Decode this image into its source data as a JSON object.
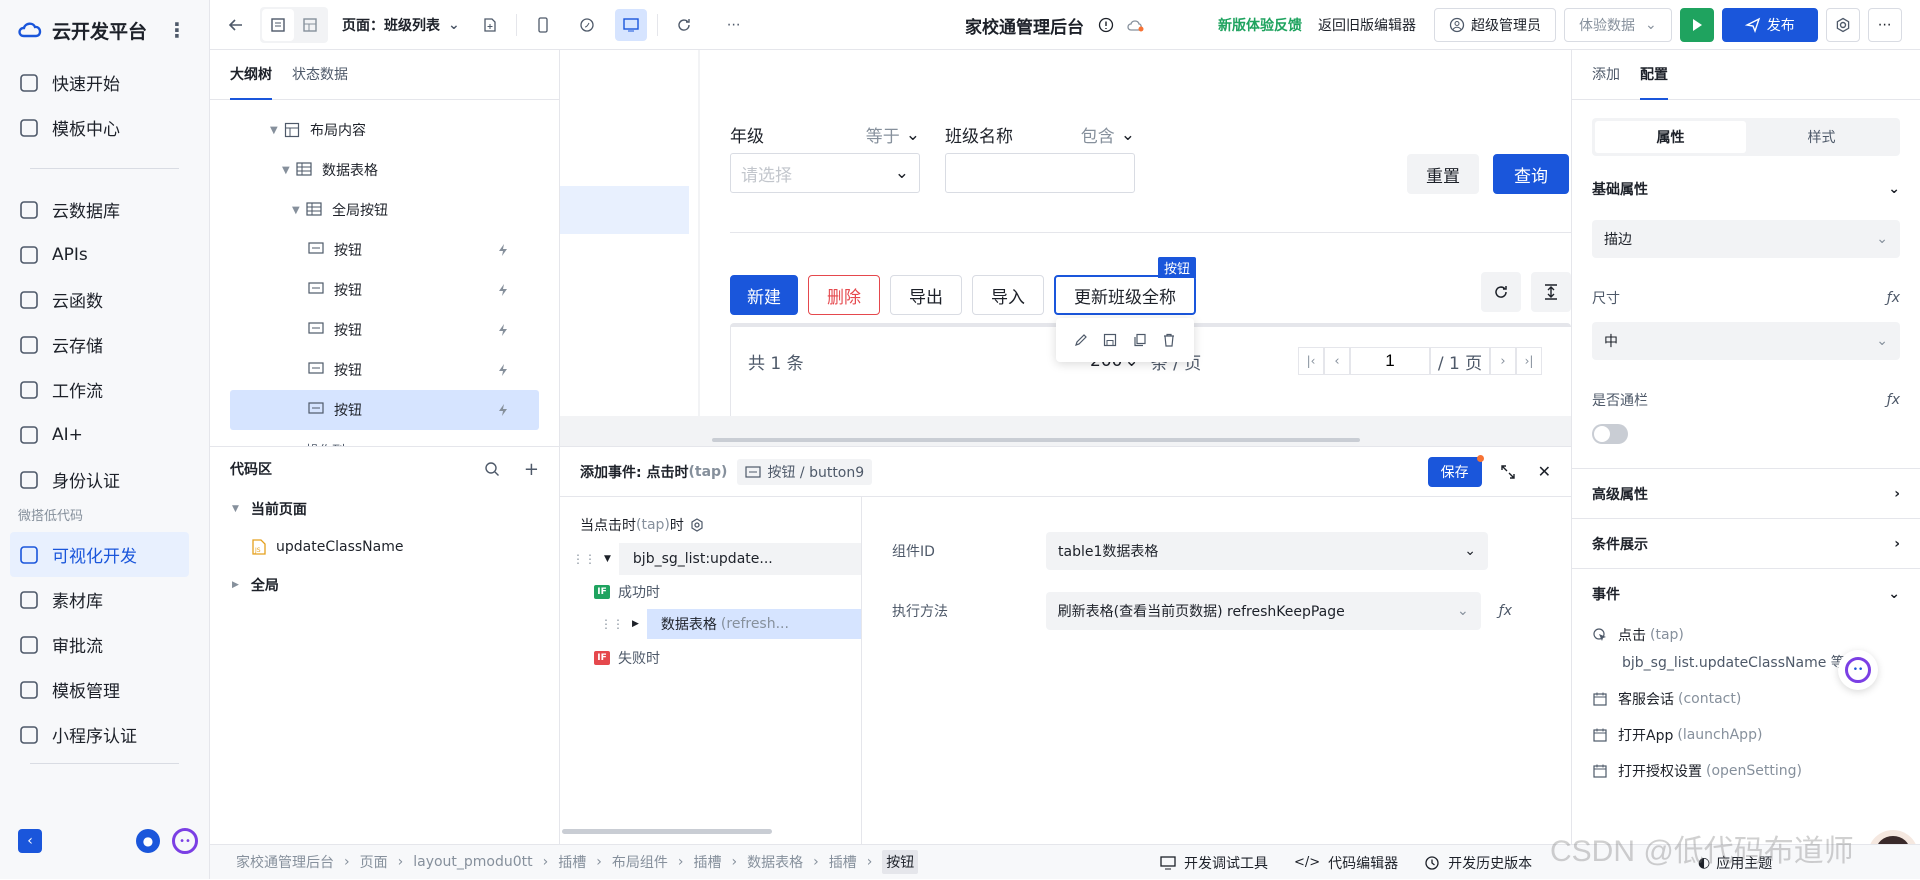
{
  "brand": {
    "name": "云开发平台"
  },
  "nav": {
    "items_top": [
      {
        "label": "快速开始",
        "icon": "flag-icon"
      },
      {
        "label": "模板中心",
        "icon": "template-icon"
      }
    ],
    "items_mid": [
      {
        "label": "云数据库",
        "icon": "database-icon"
      },
      {
        "label": "APIs",
        "icon": "link-icon"
      },
      {
        "label": "云函数",
        "icon": "function-icon"
      },
      {
        "label": "云存储",
        "icon": "folder-icon"
      },
      {
        "label": "工作流",
        "icon": "workflow-icon"
      },
      {
        "label": "AI+",
        "icon": "robot-icon"
      },
      {
        "label": "身份认证",
        "icon": "id-card-icon"
      }
    ],
    "section_label": "微搭低代码",
    "items_low": [
      {
        "label": "可视化开发",
        "icon": "visual-icon",
        "active": true
      },
      {
        "label": "素材库",
        "icon": "assets-icon"
      },
      {
        "label": "审批流",
        "icon": "approval-icon"
      },
      {
        "label": "模板管理",
        "icon": "manage-icon"
      },
      {
        "label": "小程序认证",
        "icon": "miniapp-icon"
      }
    ]
  },
  "toolbar": {
    "page_label": "页面：班级列表",
    "app_title": "家校通管理后台",
    "feedback": "新版体验反馈",
    "back_old": "返回旧版编辑器",
    "admin": "超级管理员",
    "data_select": "体验数据",
    "publish": "发布"
  },
  "outline": {
    "tabs": [
      "大纲树",
      "状态数据"
    ],
    "tree": [
      {
        "label": "布局内容",
        "indent": 0,
        "icon": "layout-icon",
        "caret": true
      },
      {
        "label": "数据表格",
        "indent": 1,
        "icon": "table-icon",
        "caret": true
      },
      {
        "label": "全局按钮",
        "indent": 2,
        "icon": "table-icon",
        "caret": true
      },
      {
        "label": "按钮",
        "indent": 3,
        "icon": "button-icon",
        "bolt": true
      },
      {
        "label": "按钮",
        "indent": 3,
        "icon": "button-icon",
        "bolt": true
      },
      {
        "label": "按钮",
        "indent": 3,
        "icon": "button-icon",
        "bolt": true
      },
      {
        "label": "按钮",
        "indent": 3,
        "icon": "button-icon",
        "bolt": true
      },
      {
        "label": "按钮",
        "indent": 3,
        "icon": "button-icon",
        "bolt": true,
        "selected": true
      }
    ],
    "partial_label": "操作列"
  },
  "code": {
    "title": "代码区",
    "current_page": "当前页面",
    "file": "updateClassName",
    "global": "全局"
  },
  "canvas": {
    "filters": [
      {
        "label": "年级",
        "op": "等于",
        "placeholder": "请选择"
      },
      {
        "label": "班级名称",
        "op": "包含",
        "placeholder": ""
      }
    ],
    "reset": "重置",
    "query": "查询",
    "buttons": [
      "新建",
      "删除",
      "导出",
      "导入",
      "更新班级全称"
    ],
    "selected_tag": "按钮",
    "total": "共 1 条",
    "page_size": "200",
    "per_page": "条 / 页",
    "page": "1",
    "page_total": "/ 1 页"
  },
  "event": {
    "title": "添加事件: 点击时",
    "title_suffix": "(tap)",
    "crumb": "按钮 / button9",
    "save": "保存",
    "trigger": "当点击时",
    "trigger_suffix": "(tap)",
    "trigger_end": "时",
    "node1": "bjb_sg_list:update...",
    "success": "成功时",
    "node2": "数据表格",
    "node2_suffix": "(refresh...",
    "fail": "失败时",
    "field1_label": "组件ID",
    "field1_value": "table1数据表格",
    "field2_label": "执行方法",
    "field2_value": "刷新表格(查看当前页数据) refreshKeepPage"
  },
  "right": {
    "tabs": [
      "添加",
      "配置"
    ],
    "seg": [
      "属性",
      "样式"
    ],
    "basic": "基础属性",
    "border_value": "描边",
    "size_label": "尺寸",
    "size_value": "中",
    "full_label": "是否通栏",
    "advanced": "高级属性",
    "condition": "条件展示",
    "events": "事件",
    "event_items": [
      {
        "name": "点击",
        "code": "(tap)",
        "sub": "bjb_sg_list.updateClassName 等1..."
      },
      {
        "name": "客服会话",
        "code": "(contact)"
      },
      {
        "name": "打开App",
        "code": "(launchApp)"
      },
      {
        "name": "打开授权设置",
        "code": "(openSetting)"
      }
    ],
    "theme": "应用主题"
  },
  "statusbar": {
    "crumbs": [
      "家校通管理后台",
      "页面",
      "layout_pmodu0tt",
      "插槽",
      "布局组件",
      "插槽",
      "数据表格",
      "插槽",
      "按钮"
    ],
    "tools": [
      "开发调试工具",
      "代码编辑器",
      "开发历史版本"
    ]
  },
  "watermark": "CSDN @低代码布道师",
  "colors": {
    "accent": "#1a56db",
    "green": "#1fa35f",
    "danger": "#e5484d"
  }
}
